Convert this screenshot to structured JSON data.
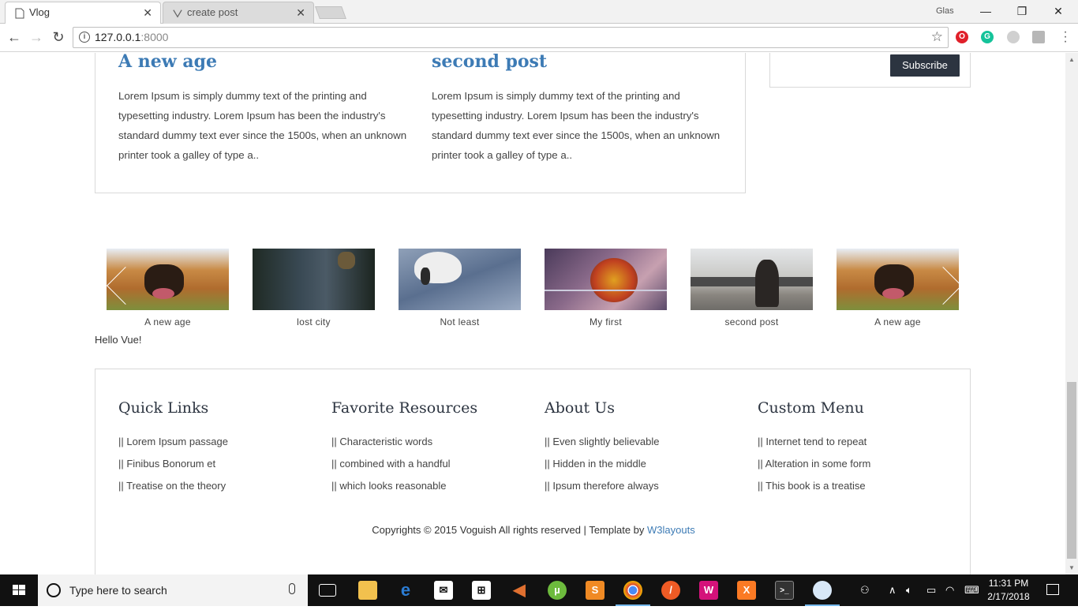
{
  "browser": {
    "tabs": [
      {
        "title": "Vlog",
        "active": true
      },
      {
        "title": "create post",
        "active": false
      }
    ],
    "profile": "Glas",
    "url_host": "127.0.0.1",
    "url_port": ":8000"
  },
  "posts": [
    {
      "title": "A new age",
      "excerpt": "Lorem Ipsum is simply dummy text of the printing and typesetting industry. Lorem Ipsum has been the industry's standard dummy text ever since the 1500s, when an unknown printer took a galley of type a.."
    },
    {
      "title": "second post",
      "excerpt": "Lorem Ipsum is simply dummy text of the printing and typesetting industry. Lorem Ipsum has been the industry's standard dummy text ever since the 1500s, when an unknown printer took a galley of type a.."
    }
  ],
  "sidebar": {
    "subscribe_label": "Subscribe"
  },
  "carousel": [
    {
      "caption": "A new age"
    },
    {
      "caption": "lost city"
    },
    {
      "caption": "Not least"
    },
    {
      "caption": "My first"
    },
    {
      "caption": "second post"
    },
    {
      "caption": "A new age"
    }
  ],
  "hello": "Hello Vue!",
  "footer": {
    "columns": [
      {
        "heading": "Quick Links",
        "items": [
          "|| Lorem Ipsum passage",
          "|| Finibus Bonorum et",
          "|| Treatise on the theory"
        ]
      },
      {
        "heading": "Favorite Resources",
        "items": [
          "|| Characteristic words",
          "|| combined with a handful",
          "|| which looks reasonable"
        ]
      },
      {
        "heading": "About Us",
        "items": [
          "|| Even slightly believable",
          "|| Hidden in the middle",
          "|| Ipsum therefore always"
        ]
      },
      {
        "heading": "Custom Menu",
        "items": [
          "|| Internet tend to repeat",
          "|| Alteration in some form",
          "|| This book is a treatise"
        ]
      }
    ],
    "copyright_text": "Copyrights © 2015 Voguish All rights reserved | Template by ",
    "copyright_link": "W3layouts"
  },
  "taskbar": {
    "search_placeholder": "Type here to search",
    "time": "11:31 PM",
    "date": "2/17/2018"
  },
  "colors": {
    "link": "#3d7bb5",
    "dark_button": "#2c3440"
  }
}
